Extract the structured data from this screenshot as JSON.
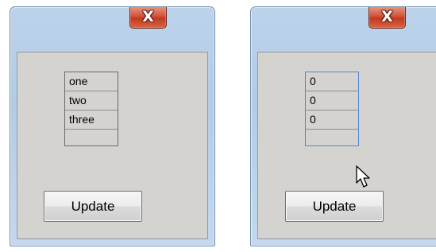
{
  "windows": [
    {
      "list_items": [
        "one",
        "two",
        "three",
        ""
      ],
      "button_label": "Update",
      "close_glyph": "X"
    },
    {
      "list_items": [
        "0",
        "0",
        "0",
        ""
      ],
      "button_label": "Update",
      "close_glyph": "X"
    }
  ],
  "colors": {
    "title_bar": "#b3cce6",
    "close_button": "#c23a22",
    "client_area": "#d5d3cf",
    "focus_border": "#4d8ad1"
  },
  "icons": {
    "close": "close-icon",
    "cursor": "mouse-cursor-icon"
  }
}
